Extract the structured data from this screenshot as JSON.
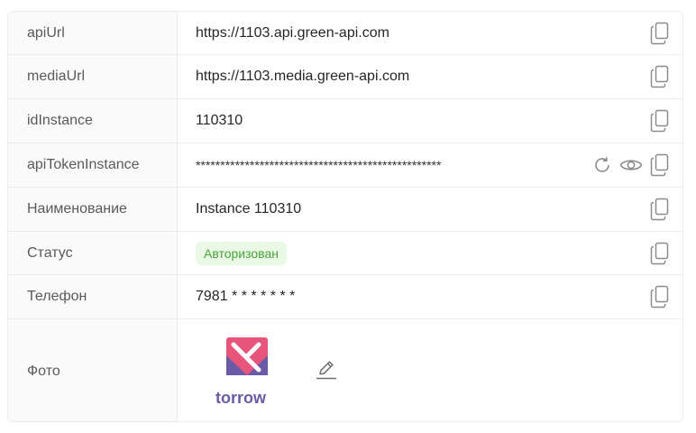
{
  "rows": [
    {
      "label": "apiUrl",
      "value": "https://1103.api.green-api.com"
    },
    {
      "label": "mediaUrl",
      "value": "https://1103.media.green-api.com"
    },
    {
      "label": "idInstance",
      "value": "110310"
    },
    {
      "label": "apiTokenInstance",
      "value": "**************************************************"
    },
    {
      "label": "Наименование",
      "value": "Instance 110310"
    },
    {
      "label": "Статус",
      "value": "Авторизован"
    },
    {
      "label": "Телефон",
      "value": "7981 * * * * * * *"
    },
    {
      "label": "Фото",
      "logo_text": "torrow"
    }
  ],
  "icons": {
    "copy": "copy-icon",
    "refresh": "refresh-icon",
    "eye": "eye-icon",
    "edit": "edit-pencil-icon"
  },
  "colors": {
    "status_bg": "#e9f9e6",
    "status_text": "#4aa23a",
    "logo_pink": "#e8557a",
    "logo_purple": "#6b5aa6"
  }
}
